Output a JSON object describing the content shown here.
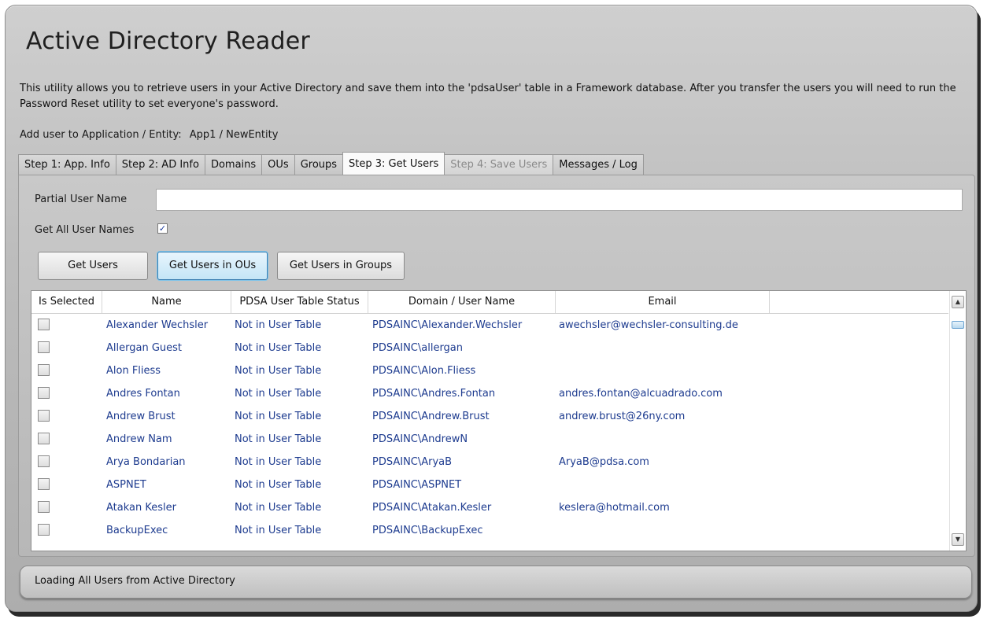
{
  "app": {
    "title": "Active Directory Reader",
    "description": "This utility allows you to retrieve users in your Active Directory and save them into the 'pdsaUser' table in a Framework database. After you transfer the users you will need to run the Password Reset utility to set everyone's password.",
    "entity_label": "Add user to Application / Entity:",
    "entity_value": "App1 / NewEntity"
  },
  "tabs": [
    {
      "label": "Step 1: App. Info",
      "state": "normal"
    },
    {
      "label": "Step 2: AD Info",
      "state": "normal"
    },
    {
      "label": "Domains",
      "state": "normal"
    },
    {
      "label": "OUs",
      "state": "normal"
    },
    {
      "label": "Groups",
      "state": "normal"
    },
    {
      "label": "Step 3: Get Users",
      "state": "active"
    },
    {
      "label": "Step 4: Save Users",
      "state": "disabled"
    },
    {
      "label": "Messages / Log",
      "state": "normal"
    }
  ],
  "form": {
    "partial_label": "Partial User Name",
    "partial_value": "",
    "getall_label": "Get All User Names",
    "getall_checked": true,
    "checkmark": "✓"
  },
  "buttons": {
    "get_users": "Get Users",
    "get_users_ous": "Get Users in OUs",
    "get_users_groups": "Get Users in Groups"
  },
  "grid": {
    "columns": [
      "Is Selected",
      "Name",
      "PDSA User Table Status",
      "Domain / User Name",
      "Email"
    ],
    "rows": [
      {
        "name": "Alexander Wechsler",
        "status": "Not in User Table",
        "domain_user": "PDSAINC\\Alexander.Wechsler",
        "email": "awechsler@wechsler-consulting.de"
      },
      {
        "name": "Allergan Guest",
        "status": "Not in User Table",
        "domain_user": "PDSAINC\\allergan",
        "email": ""
      },
      {
        "name": "Alon Fliess",
        "status": "Not in User Table",
        "domain_user": "PDSAINC\\Alon.Fliess",
        "email": ""
      },
      {
        "name": "Andres Fontan",
        "status": "Not in User Table",
        "domain_user": "PDSAINC\\Andres.Fontan",
        "email": "andres.fontan@alcuadrado.com"
      },
      {
        "name": "Andrew Brust",
        "status": "Not in User Table",
        "domain_user": "PDSAINC\\Andrew.Brust",
        "email": "andrew.brust@26ny.com"
      },
      {
        "name": "Andrew Nam",
        "status": "Not in User Table",
        "domain_user": "PDSAINC\\AndrewN",
        "email": ""
      },
      {
        "name": "Arya Bondarian",
        "status": "Not in User Table",
        "domain_user": "PDSAINC\\AryaB",
        "email": "AryaB@pdsa.com"
      },
      {
        "name": "ASPNET",
        "status": "Not in User Table",
        "domain_user": "PDSAINC\\ASPNET",
        "email": ""
      },
      {
        "name": "Atakan Kesler",
        "status": "Not in User Table",
        "domain_user": "PDSAINC\\Atakan.Kesler",
        "email": "keslera@hotmail.com"
      },
      {
        "name": "BackupExec",
        "status": "Not in User Table",
        "domain_user": "PDSAINC\\BackupExec",
        "email": ""
      }
    ]
  },
  "scrollbar": {
    "up_icon": "scroll-up-arrow-icon",
    "down_icon": "scroll-down-arrow-icon",
    "up_glyph": "▲",
    "down_glyph": "▼"
  },
  "status": {
    "text": "Loading All Users from Active Directory"
  }
}
